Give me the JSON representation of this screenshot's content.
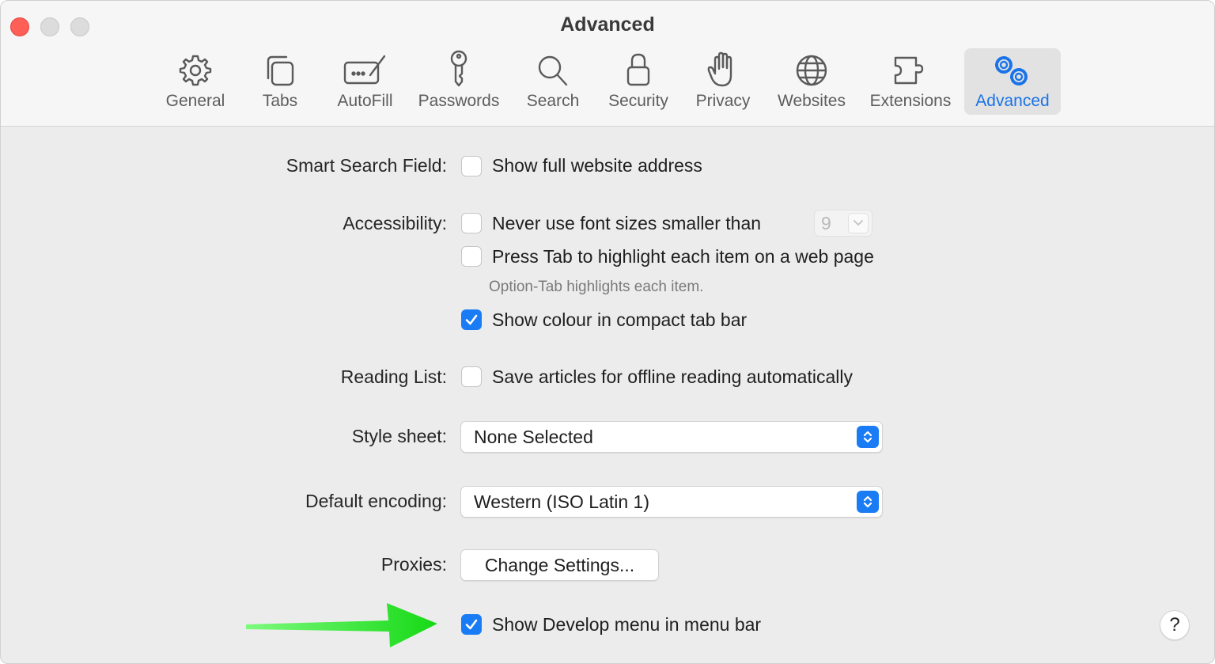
{
  "window": {
    "title": "Advanced"
  },
  "tabs": [
    {
      "id": "general",
      "label": "General",
      "icon": "gear-icon"
    },
    {
      "id": "tabs",
      "label": "Tabs",
      "icon": "tabs-icon"
    },
    {
      "id": "autofill",
      "label": "AutoFill",
      "icon": "autofill-icon"
    },
    {
      "id": "passwords",
      "label": "Passwords",
      "icon": "key-icon"
    },
    {
      "id": "search",
      "label": "Search",
      "icon": "magnifier-icon"
    },
    {
      "id": "security",
      "label": "Security",
      "icon": "lock-icon"
    },
    {
      "id": "privacy",
      "label": "Privacy",
      "icon": "hand-icon"
    },
    {
      "id": "websites",
      "label": "Websites",
      "icon": "globe-icon"
    },
    {
      "id": "extensions",
      "label": "Extensions",
      "icon": "puzzle-icon"
    },
    {
      "id": "advanced",
      "label": "Advanced",
      "icon": "gears-icon",
      "selected": true
    }
  ],
  "settings": {
    "smart_search": {
      "label": "Smart Search Field:",
      "show_full_address": {
        "text": "Show full website address",
        "checked": false
      }
    },
    "accessibility": {
      "label": "Accessibility:",
      "min_font": {
        "text": "Never use font sizes smaller than",
        "checked": false,
        "value": "9"
      },
      "press_tab": {
        "text": "Press Tab to highlight each item on a web page",
        "checked": false
      },
      "hint": "Option-Tab highlights each item.",
      "show_colour": {
        "text": "Show colour in compact tab bar",
        "checked": true
      }
    },
    "reading_list": {
      "label": "Reading List:",
      "save_offline": {
        "text": "Save articles for offline reading automatically",
        "checked": false
      }
    },
    "style_sheet": {
      "label": "Style sheet:",
      "value": "None Selected"
    },
    "default_encoding": {
      "label": "Default encoding:",
      "value": "Western (ISO Latin 1)"
    },
    "proxies": {
      "label": "Proxies:",
      "button": "Change Settings..."
    },
    "develop_menu": {
      "text": "Show Develop menu in menu bar",
      "checked": true
    }
  },
  "help": {
    "label": "?"
  },
  "colors": {
    "accent": "#1a7cf5",
    "close": "#ff5f57",
    "annotation_arrow": "#22dd22"
  }
}
